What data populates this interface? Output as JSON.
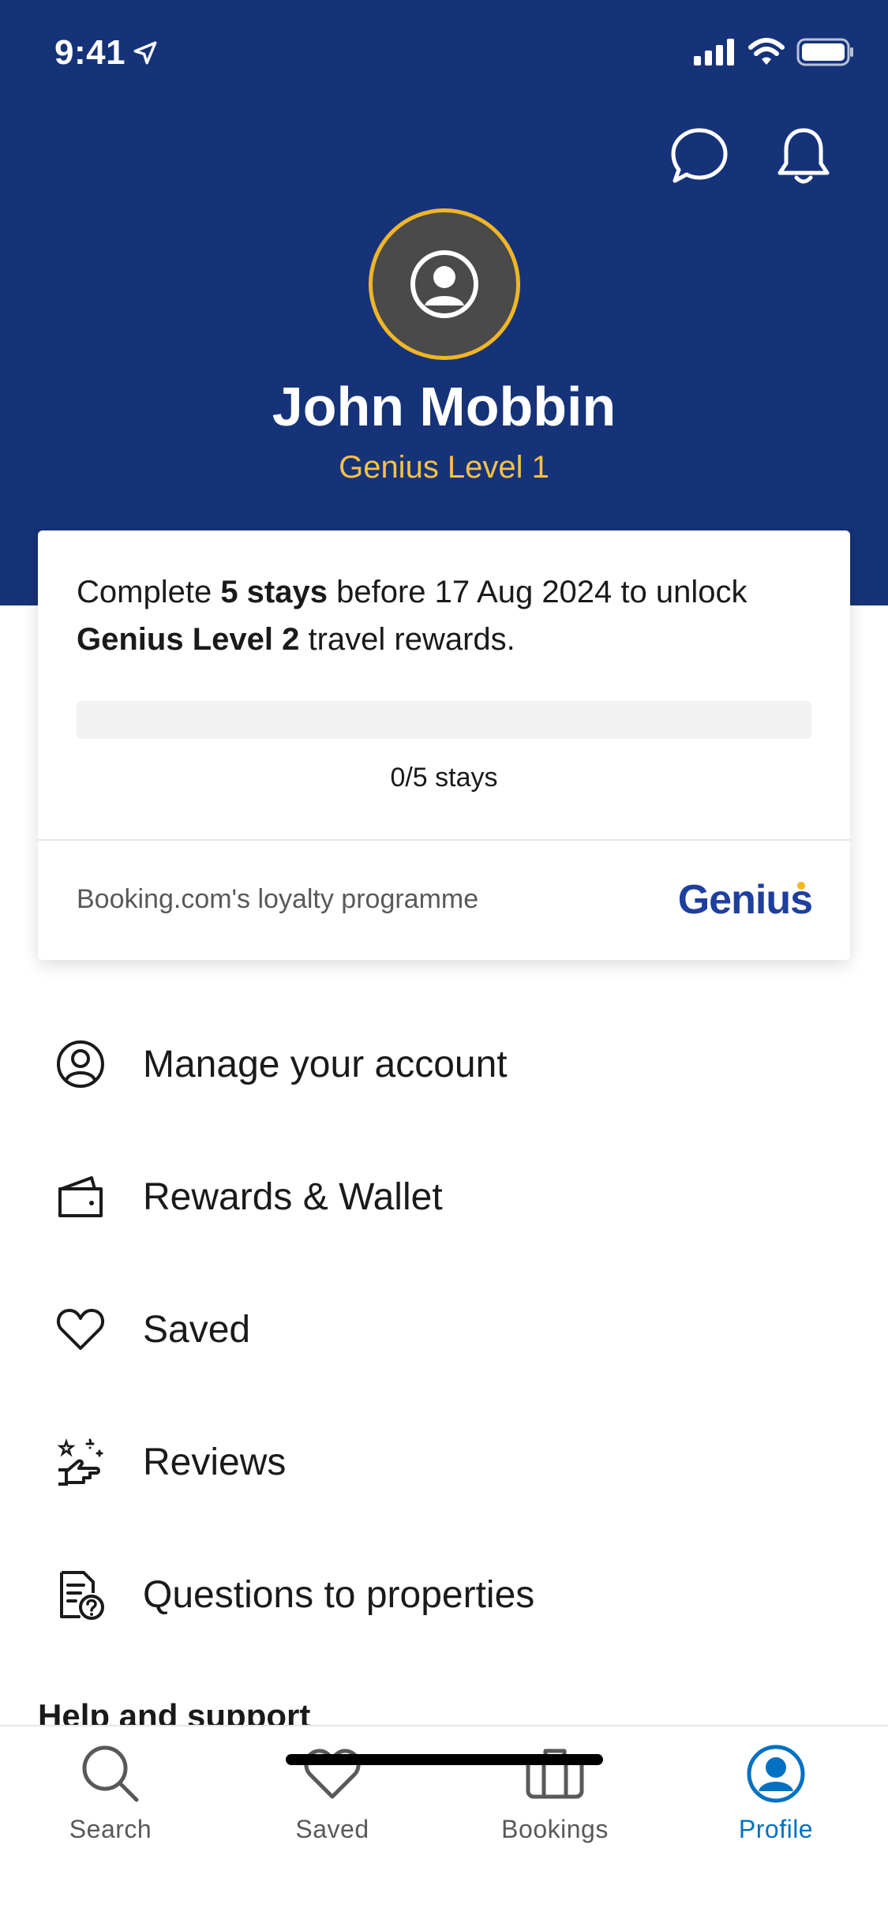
{
  "status_bar": {
    "time": "9:41"
  },
  "header": {
    "user_name": "John Mobbin",
    "genius_level": "Genius Level 1"
  },
  "genius_card": {
    "text_parts": [
      "Complete ",
      "5 stays",
      " before 17 Aug 2024 to unlock ",
      "Genius Level 2",
      " travel rewards."
    ],
    "progress_completed": 0,
    "progress_total": 5,
    "progress_label": "0/5 stays",
    "footer_text": "Booking.com's loyalty programme",
    "logo_text": "Genius"
  },
  "menu": [
    {
      "label": "Manage your account",
      "icon": "person-circle-icon"
    },
    {
      "label": "Rewards & Wallet",
      "icon": "wallet-icon"
    },
    {
      "label": "Saved",
      "icon": "heart-icon"
    },
    {
      "label": "Reviews",
      "icon": "review-hand-icon"
    },
    {
      "label": "Questions to properties",
      "icon": "document-question-icon"
    }
  ],
  "section": {
    "help_title": "Help and support"
  },
  "tabbar": {
    "tabs": [
      {
        "label": "Search",
        "icon": "search-icon",
        "active": false
      },
      {
        "label": "Saved",
        "icon": "heart-icon",
        "active": false
      },
      {
        "label": "Bookings",
        "icon": "briefcase-icon",
        "active": false
      },
      {
        "label": "Profile",
        "icon": "profile-icon",
        "active": true
      }
    ]
  },
  "colors": {
    "header_bg": "#163379",
    "accent_gold": "#f4c146",
    "brand_blue": "#0071c2"
  }
}
